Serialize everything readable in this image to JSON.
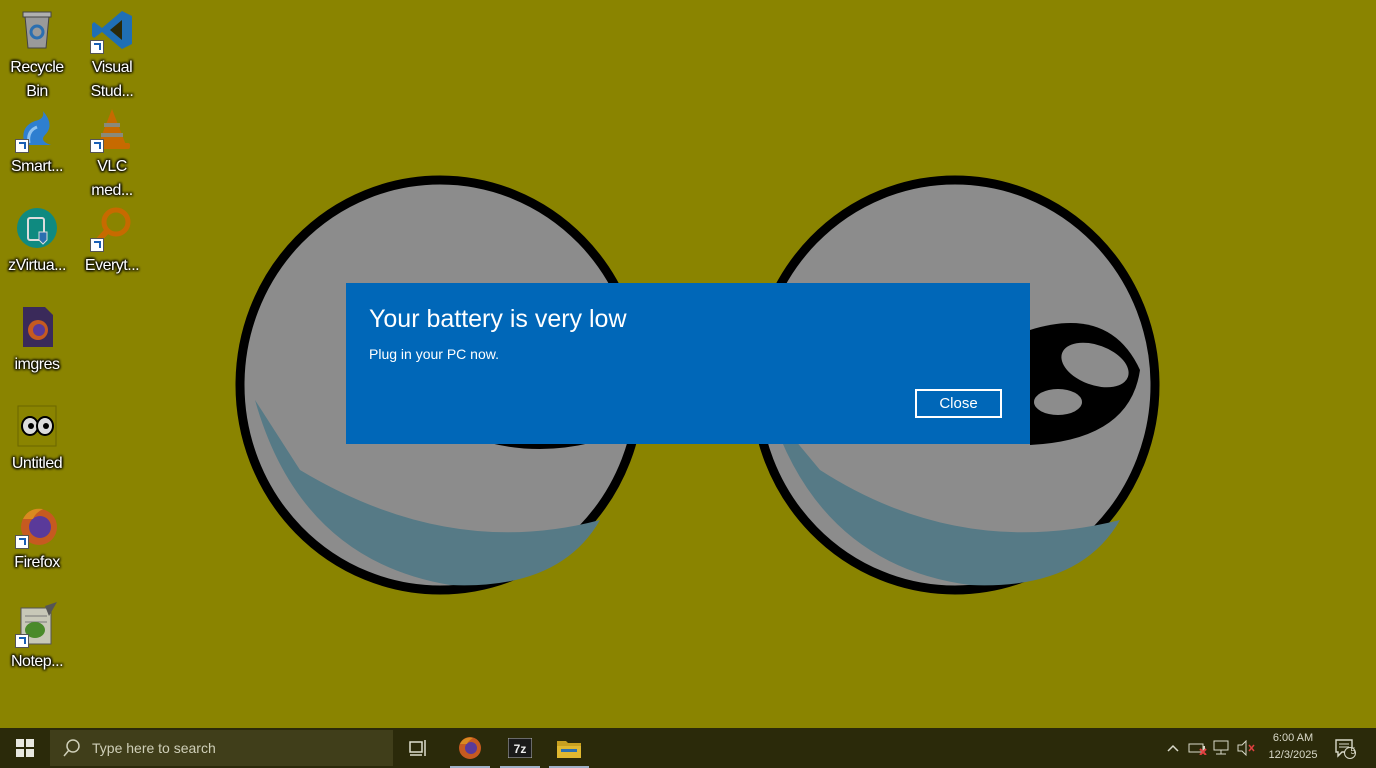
{
  "desktop": {
    "icons": [
      {
        "name": "recycle-bin",
        "label": "Recycle\nBin"
      },
      {
        "name": "visual-studio-code",
        "label": "Visual\nStud..."
      },
      {
        "name": "smartgit",
        "label": "Smart..."
      },
      {
        "name": "vlc",
        "label": "VLC\nmed..."
      },
      {
        "name": "zvirtual",
        "label": "zVirtua..."
      },
      {
        "name": "everything",
        "label": "Everyt..."
      },
      {
        "name": "imgres",
        "label": "imgres"
      },
      {
        "name": "untitled",
        "label": "Untitled"
      },
      {
        "name": "firefox",
        "label": "Firefox"
      },
      {
        "name": "notepad",
        "label": "Notep..."
      }
    ]
  },
  "toast": {
    "title": "Your battery is very low",
    "body": "Plug in your PC now.",
    "close_label": "Close",
    "background": "#0067b8"
  },
  "taskbar": {
    "search_placeholder": "Type here to search",
    "pinned": [
      "task-view-icon",
      "firefox-icon",
      "7zip-icon",
      "file-explorer-icon"
    ],
    "clock_time": "6:00 AM",
    "clock_date": "12/3/2025",
    "notification_count": "5"
  },
  "colors": {
    "desktop_bg": "#8a8400",
    "taskbar_bg": "#2b2a0a",
    "accent": "#0067b8"
  }
}
